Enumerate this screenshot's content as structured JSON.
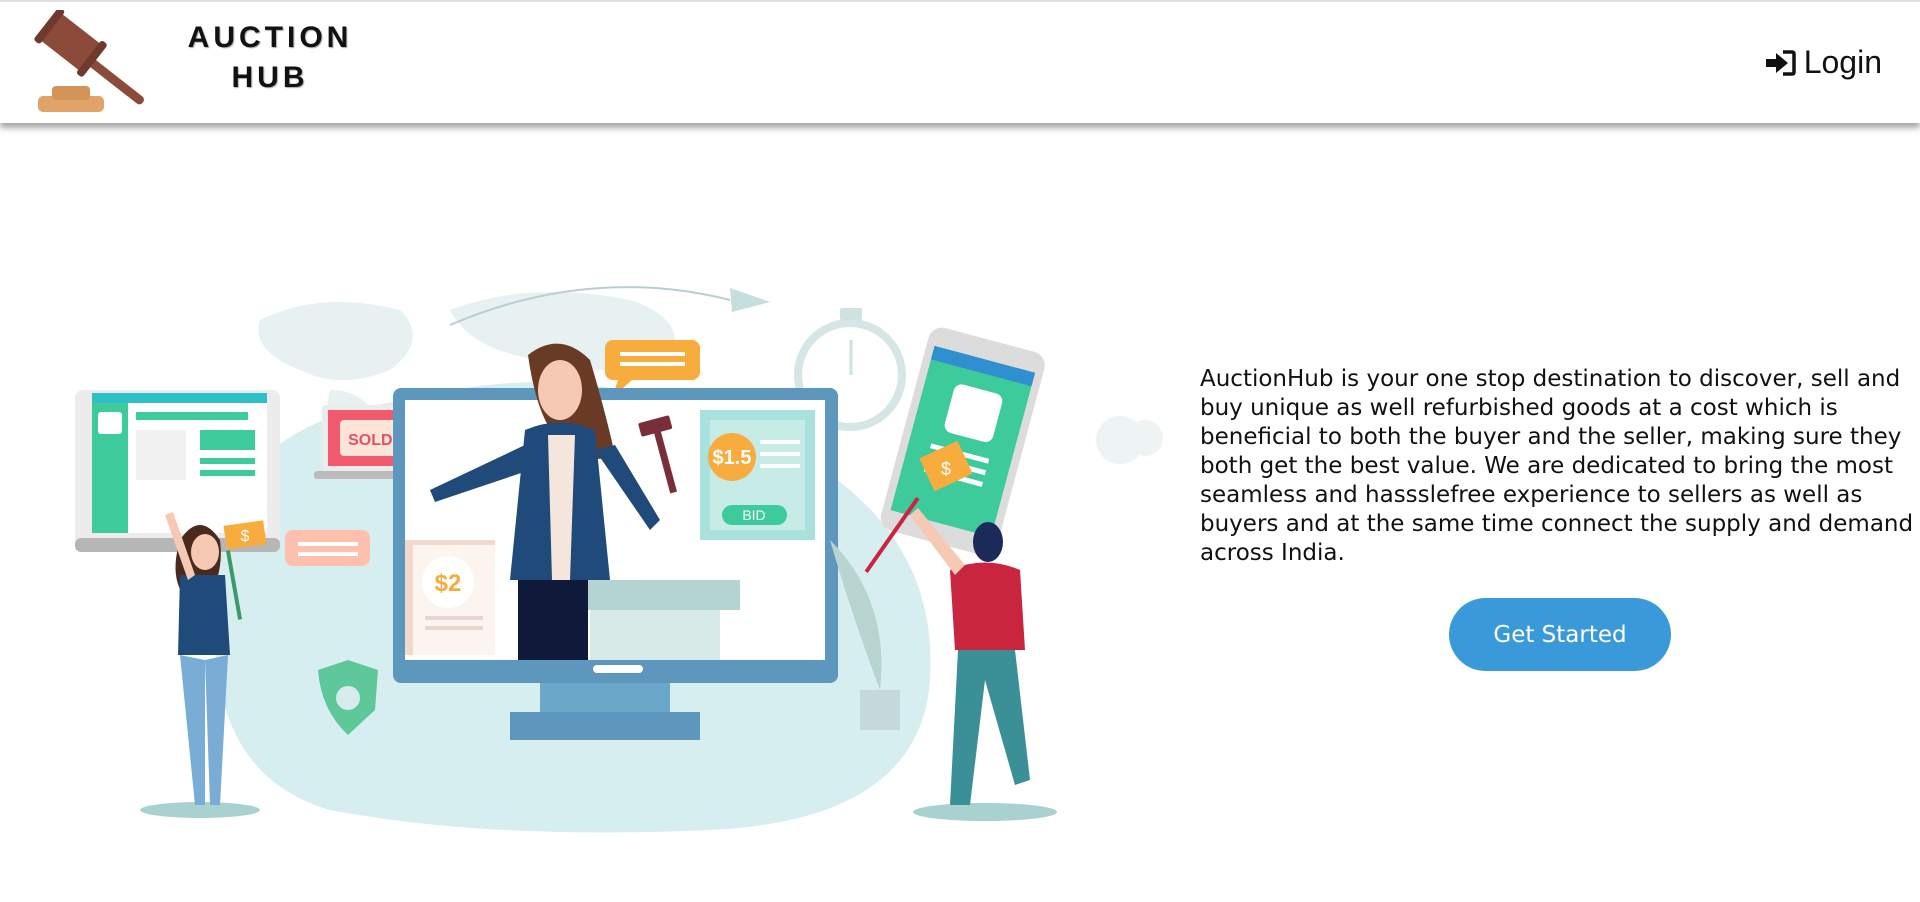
{
  "brand": {
    "line1": "AUCTION",
    "line2": "HUB"
  },
  "nav": {
    "login_label": "Login"
  },
  "hero": {
    "description": "AuctionHub is your one stop destination to discover, sell and buy unique as well refurbished goods at a cost which is beneficial to both the buyer and the seller, making sure they both get the best value. We are dedicated to bring the most seamless and hassslefree experience to sellers as well as buyers and at the same time connect the supply and demand across India.",
    "cta_label": "Get Started"
  },
  "illustration": {
    "sold_sign": "SOLD!",
    "price_tag_1": "$1.5",
    "bid_label": "BID",
    "price_tag_2": "$2",
    "dollar_sign": "$"
  },
  "colors": {
    "cta": "#3a9ad9",
    "gavel": "#8b4a3a",
    "gavel_base": "#e0a468",
    "teal": "#3ecb9c"
  }
}
